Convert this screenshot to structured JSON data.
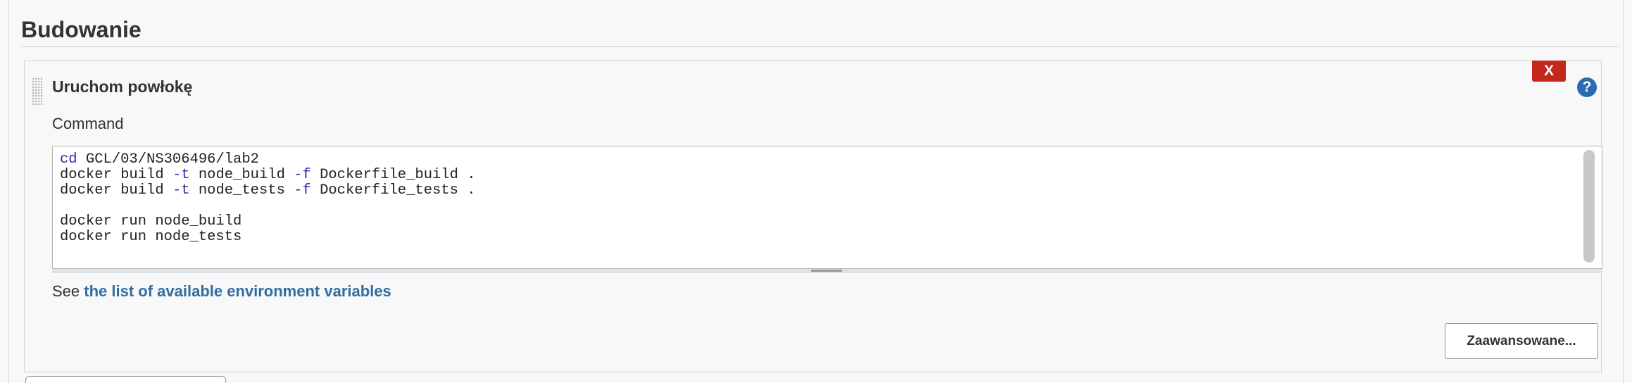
{
  "section": {
    "title": "Budowanie"
  },
  "step": {
    "title": "Uruchom powłokę",
    "delete_label": "X",
    "help_label": "?",
    "command_label": "Command",
    "command_lines": [
      [
        {
          "t": "cd",
          "k": true
        },
        {
          "t": " GCL/03/NS306496/lab2",
          "k": false
        }
      ],
      [
        {
          "t": "docker build ",
          "k": false
        },
        {
          "t": "-t",
          "k": true
        },
        {
          "t": " node_build ",
          "k": false
        },
        {
          "t": "-f",
          "k": true
        },
        {
          "t": " Dockerfile_build .",
          "k": false
        }
      ],
      [
        {
          "t": "docker build ",
          "k": false
        },
        {
          "t": "-t",
          "k": true
        },
        {
          "t": " node_tests ",
          "k": false
        },
        {
          "t": "-f",
          "k": true
        },
        {
          "t": " Dockerfile_tests .",
          "k": false
        }
      ],
      [],
      [
        {
          "t": "docker run node_build",
          "k": false
        }
      ],
      [
        {
          "t": "docker run node_tests",
          "k": false
        }
      ]
    ],
    "env_prefix": "See ",
    "env_link": "the list of available environment variables",
    "advanced_label": "Zaawansowane..."
  },
  "colors": {
    "delete_red": "#c4271c",
    "help_blue": "#2c6bb1",
    "link_blue": "#2f6da3",
    "code_keyword": "#2a2aa8"
  }
}
